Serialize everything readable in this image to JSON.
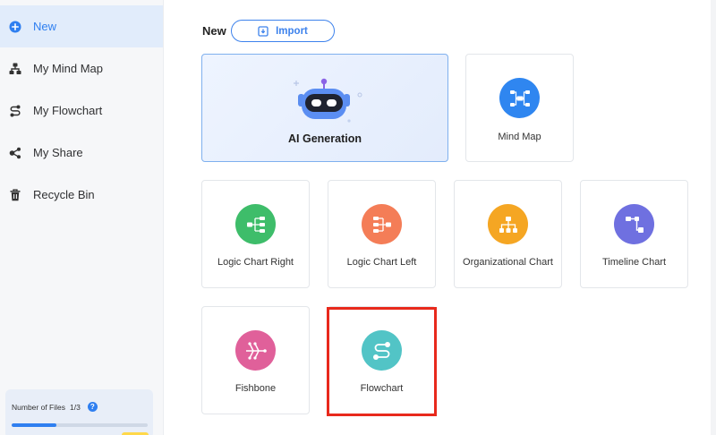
{
  "sidebar": {
    "items": [
      {
        "label": "New",
        "icon": "plus-circle-icon",
        "active": true
      },
      {
        "label": "My Mind Map",
        "icon": "mind-map-icon",
        "active": false
      },
      {
        "label": "My Flowchart",
        "icon": "flowchart-icon",
        "active": false
      },
      {
        "label": "My Share",
        "icon": "share-icon",
        "active": false
      },
      {
        "label": "Recycle Bin",
        "icon": "trash-icon",
        "active": false
      }
    ],
    "files": {
      "label": "Number of Files",
      "count": "1/3",
      "help": "?",
      "progress": 0.33
    }
  },
  "main": {
    "title": "New",
    "import_label": "Import",
    "ai_card": {
      "label": "AI Generation",
      "icon": "robot-icon"
    },
    "templates": [
      {
        "label": "Mind Map",
        "icon": "mind-map-icon",
        "color": "#2f86f0"
      },
      {
        "label": "Logic Chart Right",
        "icon": "logic-chart-right-icon",
        "color": "#3ebd6a"
      },
      {
        "label": "Logic Chart Left",
        "icon": "logic-chart-left-icon",
        "color": "#f47d57"
      },
      {
        "label": "Organizational Chart",
        "icon": "org-chart-icon",
        "color": "#f5a623"
      },
      {
        "label": "Timeline Chart",
        "icon": "timeline-chart-icon",
        "color": "#6f70e0"
      },
      {
        "label": "Fishbone",
        "icon": "fishbone-icon",
        "color": "#e0609a"
      },
      {
        "label": "Flowchart",
        "icon": "flowchart-icon",
        "color": "#52c4c6"
      }
    ]
  },
  "colors": {
    "accent": "#2f7ff0",
    "active_bg": "#e1ecfb",
    "highlight": "#e8291c"
  }
}
